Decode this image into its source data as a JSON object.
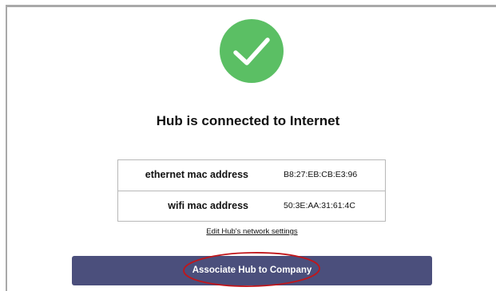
{
  "status": {
    "icon": "checkmark-icon",
    "icon_color": "#5bbf64",
    "title": "Hub is connected to Internet"
  },
  "mac_addresses": [
    {
      "label": "ethernet mac address",
      "value": "B8:27:EB:CB:E3:96"
    },
    {
      "label": "wifi mac address",
      "value": "50:3E:AA:31:61:4C"
    }
  ],
  "edit_link": {
    "label": "Edit Hub's network settings"
  },
  "associate_button": {
    "label": "Associate Hub to Company",
    "color": "#4b4f7c"
  },
  "annotation": {
    "highlight_color": "#c0161b"
  }
}
